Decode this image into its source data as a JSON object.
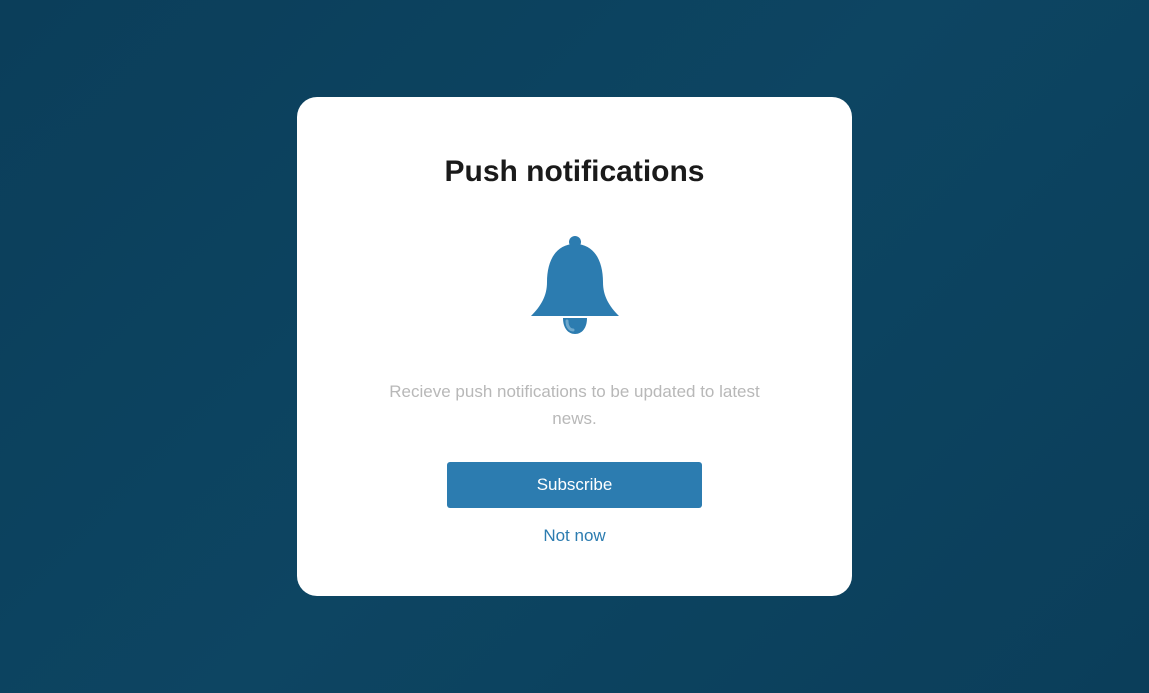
{
  "modal": {
    "title": "Push notifications",
    "description": "Recieve push notifications to be updated to latest news.",
    "subscribe_label": "Subscribe",
    "not_now_label": "Not now"
  },
  "colors": {
    "accent": "#2c7cb0",
    "bell": "#2c7cb0"
  }
}
